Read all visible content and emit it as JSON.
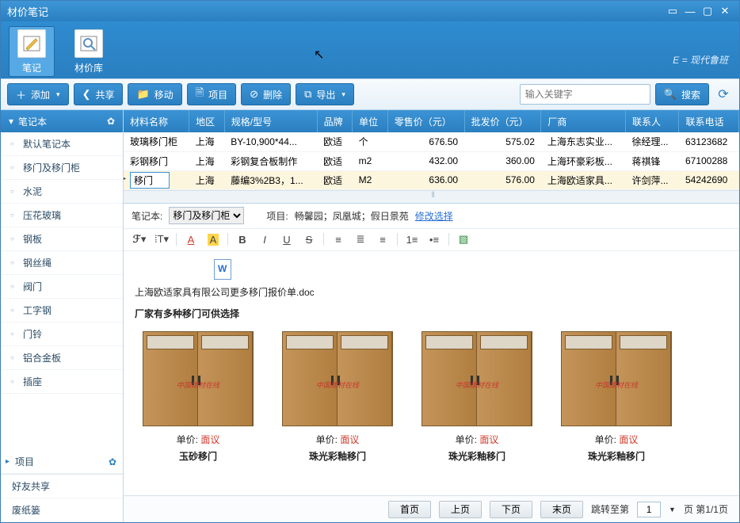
{
  "window": {
    "title": "材价笔记",
    "brand": "现代鲁班"
  },
  "ribbon": {
    "tabs": [
      {
        "label": "笔记",
        "active": true
      },
      {
        "label": "材价库",
        "active": false
      }
    ]
  },
  "toolbar": {
    "add": "添加",
    "share": "共享",
    "move": "移动",
    "project": "项目",
    "delete": "删除",
    "export": "导出",
    "search_placeholder": "输入关键字",
    "search_btn": "搜索"
  },
  "sidebar": {
    "header": "笔记本",
    "items": [
      "默认笔记本",
      "移门及移门柜",
      "水泥",
      "压花玻璃",
      "钢板",
      "钢丝绳",
      "阀门",
      "工字钢",
      "门铃",
      "铝合金板",
      "插座"
    ],
    "project": "项目",
    "bottom": [
      "好友共享",
      "废纸篓"
    ]
  },
  "table": {
    "headers": [
      "材料名称",
      "地区",
      "规格/型号",
      "品牌",
      "单位",
      "零售价（元）",
      "批发价（元）",
      "厂商",
      "联系人",
      "联系电话"
    ],
    "rows": [
      {
        "name": "玻璃移门柜",
        "region": "上海",
        "spec": "BY-10,900*44...",
        "brand": "欧适",
        "unit": "个",
        "retail": "676.50",
        "wholesale": "575.02",
        "vendor": "上海东志实业...",
        "contact": "徐经理...",
        "phone": "63123682",
        "selected": false
      },
      {
        "name": "彩钢移门",
        "region": "上海",
        "spec": "彩钢复合板制作",
        "brand": "欧适",
        "unit": "m2",
        "retail": "432.00",
        "wholesale": "360.00",
        "vendor": "上海环豪彩板...",
        "contact": "蒋祺锋",
        "phone": "67100288",
        "selected": false
      },
      {
        "name": "移门",
        "region": "上海",
        "spec": "藤编3%2B3，1...",
        "brand": "欧适",
        "unit": "M2",
        "retail": "636.00",
        "wholesale": "576.00",
        "vendor": "上海欧适家具...",
        "contact": "许剑萍...",
        "phone": "54242690",
        "selected": true
      }
    ]
  },
  "note_meta": {
    "label": "笔记本:",
    "notebook": "移门及移门柜",
    "project_label": "项目:",
    "project_value": "畅馨园；凤凰城；假日景苑",
    "modify_link": "修改选择"
  },
  "editor": {
    "doc_filename": "上海欧适家具有限公司更多移门报价单.doc",
    "headline": "厂家有多种移门可供选择",
    "price_label": "单价:",
    "price_value": "面议",
    "doors": [
      {
        "name": "玉砂移门"
      },
      {
        "name": "珠光彩釉移门"
      },
      {
        "name": "珠光彩釉移门"
      },
      {
        "name": "珠光彩釉移门"
      }
    ],
    "door_logo": "中国建材在线"
  },
  "pager": {
    "first": "首页",
    "prev": "上页",
    "next": "下页",
    "last": "末页",
    "jump_label": "跳转至第",
    "page_suffix": "页 第1/1页",
    "page_input": "1"
  }
}
